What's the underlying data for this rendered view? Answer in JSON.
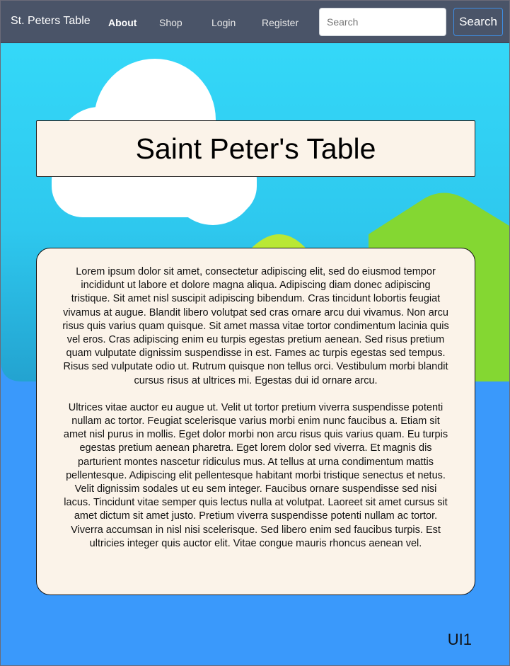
{
  "navbar": {
    "brand": "St. Peters Table",
    "links": [
      {
        "label": "About"
      },
      {
        "label": "Shop"
      },
      {
        "label": "Login"
      },
      {
        "label": "Register"
      }
    ],
    "search": {
      "placeholder": "Search",
      "value": ""
    },
    "search_button": "Search"
  },
  "hero": {
    "title": "Saint Peter's Table"
  },
  "content": {
    "paragraphs": [
      "Lorem ipsum dolor sit amet, consectetur adipiscing elit, sed do eiusmod tempor incididunt ut labore et dolore magna aliqua. Adipiscing diam donec adipiscing tristique. Sit amet nisl suscipit adipiscing bibendum. Cras tincidunt lobortis feugiat vivamus at augue. Blandit libero volutpat sed cras ornare arcu dui vivamus. Non arcu risus quis varius quam quisque. Sit amet massa vitae tortor condimentum lacinia quis vel eros. Cras adipiscing enim eu turpis egestas pretium aenean. Sed risus pretium quam vulputate dignissim suspendisse in est. Fames ac turpis egestas sed tempus. Risus sed vulputate odio ut. Rutrum quisque non tellus orci. Vestibulum morbi blandit cursus risus at ultrices mi. Egestas dui id ornare arcu.",
      "Ultrices vitae auctor eu augue ut. Velit ut tortor pretium viverra suspendisse potenti nullam ac tortor. Feugiat scelerisque varius morbi enim nunc faucibus a. Etiam sit amet nisl purus in mollis. Eget dolor morbi non arcu risus quis varius quam. Eu turpis egestas pretium aenean pharetra. Eget lorem dolor sed viverra. Et magnis dis parturient montes nascetur ridiculus mus. At tellus at urna condimentum mattis pellentesque. Adipiscing elit pellentesque habitant morbi tristique senectus et netus. Velit dignissim sodales ut eu sem integer. Faucibus ornare suspendisse sed nisi lacus. Tincidunt vitae semper quis lectus nulla at volutpat. Laoreet sit amet cursus sit amet dictum sit amet justo. Pretium viverra suspendisse potenti nullam ac tortor. Viverra accumsan in nisl nisi scelerisque. Sed libero enim sed faucibus turpis. Est ultricies integer quis auctor elit. Vitae congue mauris rhoncus aenean vel."
    ]
  },
  "footer": {
    "label": "UI1"
  },
  "colors": {
    "navbar": "#4a5468",
    "sky_top": "#33d6f7",
    "sky_bottom": "#27a9d6",
    "page_background": "#3a99fb",
    "hill_green": "#84d732",
    "hill_lime": "#b9e835",
    "cloud": "#ffffff",
    "panel": "#fbf3e9"
  }
}
